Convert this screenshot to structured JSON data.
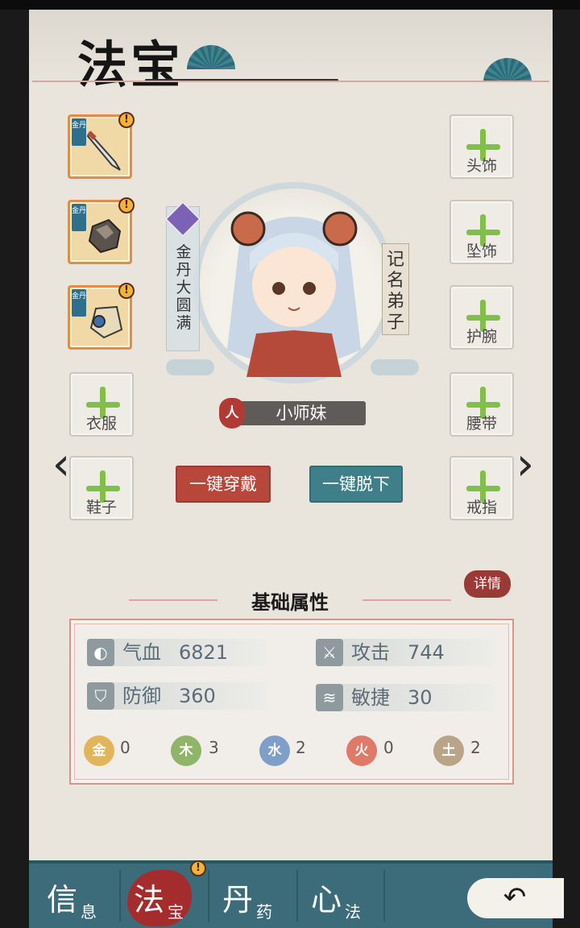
{
  "header": {
    "title": "法宝"
  },
  "left_slots": [
    {
      "label": "",
      "grade": "金丹",
      "alert": "!",
      "item": "sword"
    },
    {
      "label": "",
      "grade": "金丹",
      "alert": "!",
      "item": "stone"
    },
    {
      "label": "",
      "grade": "金丹",
      "alert": "!",
      "item": "bell"
    },
    {
      "label": "衣服"
    },
    {
      "label": "鞋子"
    }
  ],
  "right_slots": [
    {
      "label": "头饰"
    },
    {
      "label": "坠饰"
    },
    {
      "label": "护腕"
    },
    {
      "label": "腰带"
    },
    {
      "label": "戒指"
    }
  ],
  "character": {
    "realm": "金丹大圆满",
    "rank": "记名弟子",
    "name_icon": "人",
    "name": "小师妹"
  },
  "buttons": {
    "wear_all": "一键穿戴",
    "remove_all": "一键脱下"
  },
  "stats": {
    "detail": "详情",
    "section_title": "基础属性",
    "hp_label": "气血",
    "hp_value": "6821",
    "atk_label": "攻击",
    "atk_value": "744",
    "def_label": "防御",
    "def_value": "360",
    "agi_label": "敏捷",
    "agi_value": "30",
    "elements": [
      {
        "glyph": "金",
        "count": "0",
        "color": "#e2b55a"
      },
      {
        "glyph": "木",
        "count": "3",
        "color": "#8fb46a"
      },
      {
        "glyph": "水",
        "count": "2",
        "color": "#7f9fc8"
      },
      {
        "glyph": "火",
        "count": "0",
        "color": "#e07a68"
      },
      {
        "glyph": "土",
        "count": "2",
        "color": "#b9a488"
      }
    ]
  },
  "nav": {
    "tabs": [
      {
        "big": "信",
        "small": "息"
      },
      {
        "big": "法",
        "small": "宝"
      },
      {
        "big": "丹",
        "small": "药"
      },
      {
        "big": "心",
        "small": "法"
      }
    ],
    "alert": "!"
  },
  "colors": {
    "primary_teal": "#3c6c7a",
    "accent_red": "#b6473a",
    "slot_orange": "#e58b48"
  }
}
